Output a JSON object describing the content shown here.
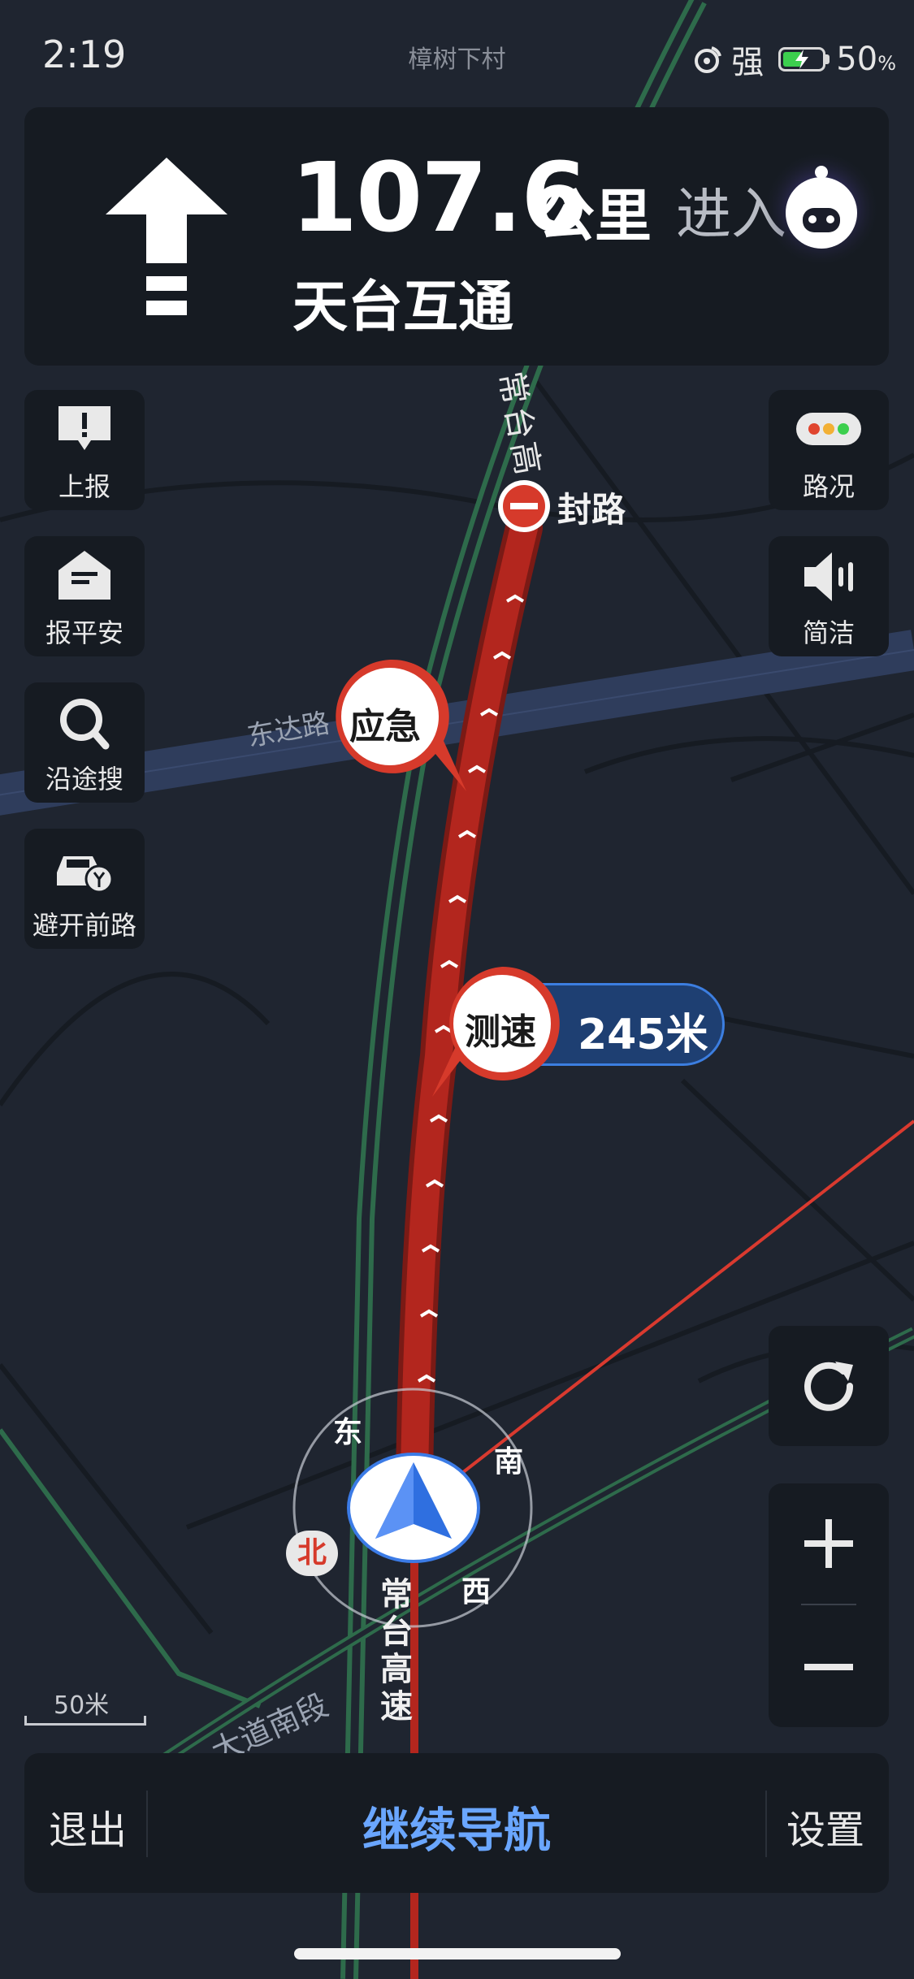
{
  "status_bar": {
    "time": "2:19",
    "place": "樟树下村",
    "signal": "强",
    "battery_pct": "50",
    "battery_unit": "%",
    "battery_level": 0.5,
    "charging_color": "#3ccf4e"
  },
  "guidance": {
    "arrow_icon": "straight-arrow-icon",
    "distance": "107.6",
    "unit": "公里",
    "action": "进入",
    "road_name": "天台互通"
  },
  "left_buttons": [
    {
      "label": "上报",
      "icon": "report-icon"
    },
    {
      "label": "报平安",
      "icon": "safe-envelope-icon"
    },
    {
      "label": "沿途搜",
      "icon": "search-icon"
    },
    {
      "label": "避开前路",
      "icon": "avoid-car-icon"
    }
  ],
  "right_buttons": [
    {
      "label": "路况",
      "icon": "traffic-light-icon"
    },
    {
      "label": "简洁",
      "icon": "speaker-icon"
    }
  ],
  "map": {
    "roads": [
      "常台高",
      "常台高速",
      "东达路",
      "大道南段"
    ],
    "road_closure_label": "封路",
    "emergency_label": "应急",
    "speed_camera_label": "测速",
    "speed_camera_distance": "245米",
    "compass": {
      "east": "东",
      "south": "南",
      "west": "西",
      "north": "北"
    },
    "scale": "50米",
    "route_color": "#b3261e"
  },
  "bottom_bar": {
    "exit": "退出",
    "continue": "继续导航",
    "settings": "设置"
  }
}
